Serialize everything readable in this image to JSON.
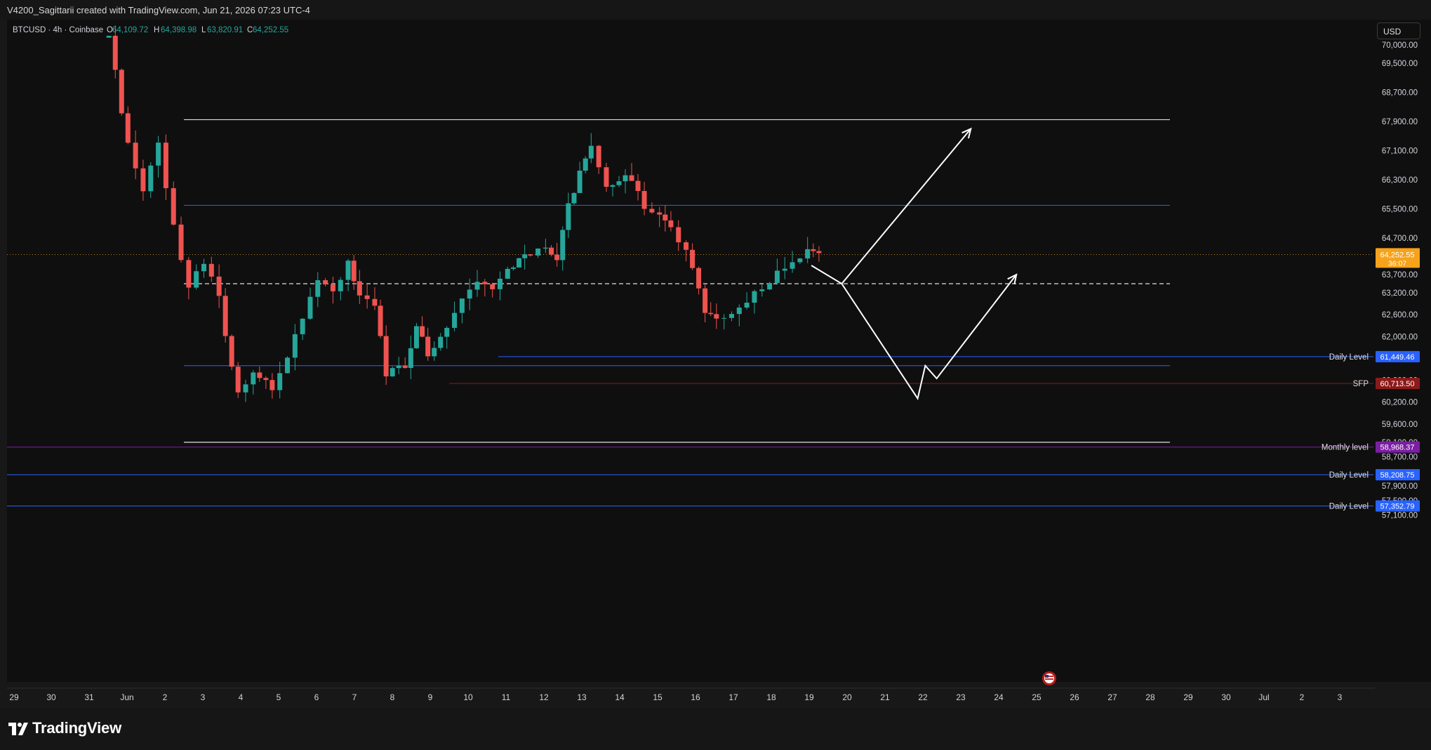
{
  "header": {
    "credit": "V4200_Sagittarii created with TradingView.com, Jun 21, 2026 07:23 UTC-4"
  },
  "symbol": {
    "name": "BTCUSD · 4h · Coinbase",
    "o_label": "O",
    "o_value": "64,109.72",
    "h_label": "H",
    "h_value": "64,398.98",
    "l_label": "L",
    "l_value": "63,820.91",
    "c_label": "C",
    "c_value": "64,252.55"
  },
  "currency_button": "USD",
  "price_axis": {
    "ticks": [
      "70,000.00",
      "69,500.00",
      "68,700.00",
      "67,900.00",
      "67,100.00",
      "66,300.00",
      "65,500.00",
      "64,700.00",
      "63,700.00",
      "63,200.00",
      "62,600.00",
      "62,000.00",
      "60,800.00",
      "60,200.00",
      "59,600.00",
      "59,100.00",
      "58,700.00",
      "58,200.00",
      "57,900.00",
      "57,500.00",
      "57,100.00"
    ],
    "current_price": "64,252.55",
    "countdown": "36:07"
  },
  "levels": [
    {
      "label": "Daily Level",
      "value": "61,449.46",
      "color": "#2962ff"
    },
    {
      "label": "SFP",
      "value": "60,713.50",
      "color": "#8b1a1a"
    },
    {
      "label": "Monthly level",
      "value": "58,968.37",
      "color": "#7b1fa2"
    },
    {
      "label": "Daily Level",
      "value": "58,208.75",
      "color": "#2962ff"
    },
    {
      "label": "Daily Level",
      "value": "57,352.79",
      "color": "#2962ff"
    }
  ],
  "time_axis": [
    "29",
    "30",
    "31",
    "Jun",
    "2",
    "3",
    "4",
    "5",
    "6",
    "7",
    "8",
    "9",
    "10",
    "11",
    "12",
    "13",
    "14",
    "15",
    "16",
    "17",
    "18",
    "19",
    "20",
    "21",
    "22",
    "23",
    "24",
    "25",
    "26",
    "27",
    "28",
    "29",
    "30",
    "Jul",
    "2",
    "3"
  ],
  "chart_data": {
    "type": "candlestick",
    "symbol": "BTCUSD",
    "interval": "4h",
    "exchange": "Coinbase",
    "last": {
      "open": 64109.72,
      "high": 64398.98,
      "low": 63820.91,
      "close": 64252.55
    },
    "y_range": [
      56900,
      70200
    ],
    "colors": {
      "up": "#26a69a",
      "down": "#ef5350",
      "current_price": "#f7a21b"
    },
    "horizontal_levels": [
      67950,
      65600,
      63450,
      61449.46,
      61200,
      60713.5,
      59100,
      58968.37,
      58208.75,
      57352.79
    ],
    "projection_paths": [
      [
        [
          "21",
          63950
        ],
        [
          "21.8",
          63450
        ],
        [
          "23.8",
          60300
        ],
        [
          "24",
          61200
        ],
        [
          "24.3",
          60850
        ],
        [
          "26.4",
          63700
        ]
      ],
      [
        [
          "21.8",
          63450
        ],
        [
          "25.2",
          67700
        ]
      ]
    ]
  },
  "footer": {
    "brand": "TradingView"
  }
}
